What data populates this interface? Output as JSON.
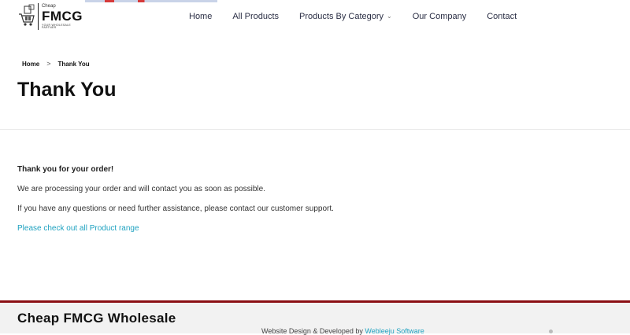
{
  "header": {
    "logo": {
      "small_text": "Cheap",
      "brand": "FMCG",
      "tagline": "YOUR WHOLESALE PARTNER"
    },
    "nav": [
      {
        "label": "Home"
      },
      {
        "label": "All Products"
      },
      {
        "label": "Products By Category",
        "has_dropdown": true
      },
      {
        "label": "Our Company"
      },
      {
        "label": "Contact"
      }
    ]
  },
  "breadcrumb": {
    "home": "Home",
    "separator": ">",
    "current": "Thank You"
  },
  "page_title": "Thank You",
  "content": {
    "thanks": "Thank you for your order!",
    "processing": "We are processing your order and will contact you as soon as possible.",
    "support": "If you have any questions or need further assistance, please contact our customer support.",
    "product_link": "Please check out all Product range"
  },
  "footer": {
    "brand": "Cheap FMCG Wholesale",
    "credit_prefix": "Website Design & Developed by ",
    "credit_link": "Webleeju Software"
  },
  "colors": {
    "link": "#1fa2c0",
    "footer_border": "#8b0f14",
    "nav_text": "#2b2f45"
  }
}
